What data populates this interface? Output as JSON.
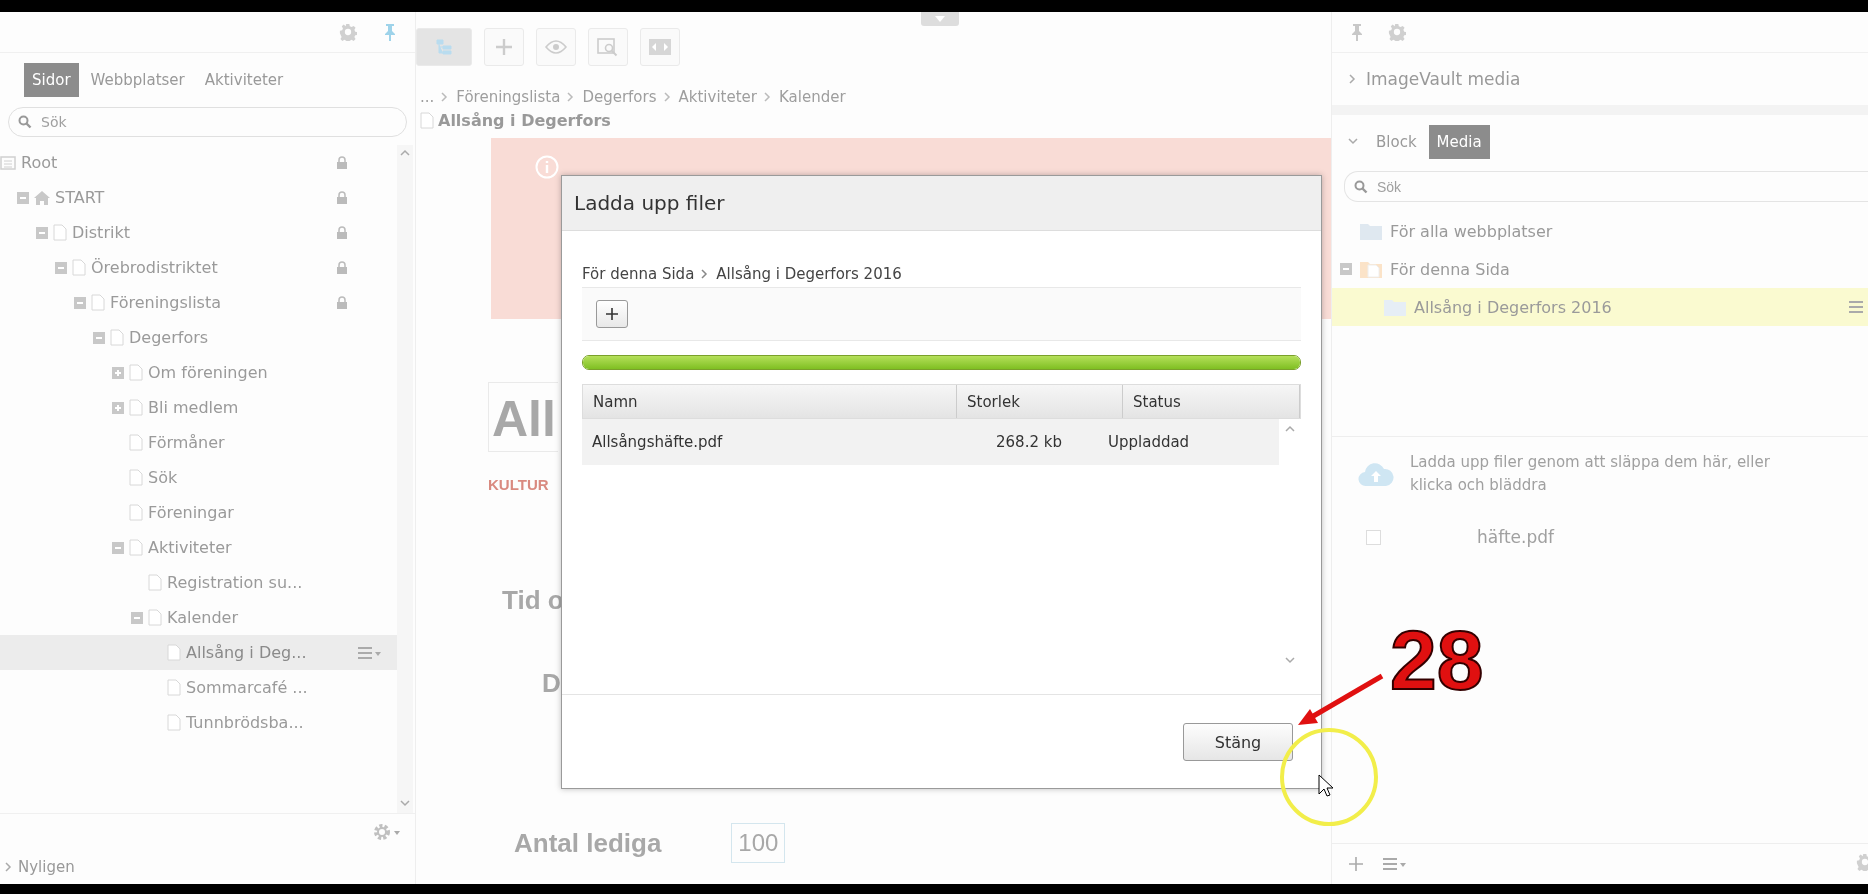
{
  "left_panel": {
    "tabs": [
      {
        "label": "Sidor",
        "selected": true
      },
      {
        "label": "Webbplatser",
        "selected": false
      },
      {
        "label": "Aktiviteter",
        "selected": false
      }
    ],
    "search": {
      "placeholder": "Sök"
    },
    "tree": [
      {
        "label": "Root",
        "kind": "root",
        "locked": true,
        "selected": false,
        "children": [
          {
            "label": "START",
            "kind": "home",
            "locked": true,
            "selected": false,
            "expanded": true,
            "children": [
              {
                "label": "Distrikt",
                "kind": "page",
                "locked": true,
                "selected": false,
                "expanded": true,
                "children": [
                  {
                    "label": "Örebrodistriktet",
                    "kind": "page",
                    "locked": true,
                    "selected": false,
                    "expanded": true,
                    "children": [
                      {
                        "label": "Föreningslista",
                        "kind": "page",
                        "locked": true,
                        "selected": false,
                        "expanded": true,
                        "children": [
                          {
                            "label": "Degerfors",
                            "kind": "page",
                            "locked": false,
                            "selected": false,
                            "expanded": true,
                            "children": [
                              {
                                "label": "Om föreningen",
                                "kind": "page",
                                "locked": false,
                                "selected": false,
                                "expanded": false
                              },
                              {
                                "label": "Bli medlem",
                                "kind": "page",
                                "locked": false,
                                "selected": false,
                                "expanded": false
                              },
                              {
                                "label": "Förmåner",
                                "kind": "page",
                                "locked": false,
                                "selected": false
                              },
                              {
                                "label": "Sök",
                                "kind": "page",
                                "locked": false,
                                "selected": false
                              },
                              {
                                "label": "Föreningar",
                                "kind": "page",
                                "locked": false,
                                "selected": false
                              },
                              {
                                "label": "Aktiviteter",
                                "kind": "page",
                                "locked": false,
                                "selected": false,
                                "expanded": true,
                                "children": [
                                  {
                                    "label": "Registration su...",
                                    "kind": "page",
                                    "locked": false,
                                    "selected": false
                                  },
                                  {
                                    "label": "Kalender",
                                    "kind": "page",
                                    "locked": false,
                                    "selected": false,
                                    "expanded": true,
                                    "children": [
                                      {
                                        "label": "Allsång i Deg...",
                                        "kind": "page",
                                        "locked": false,
                                        "selected": true
                                      },
                                      {
                                        "label": "Sommarcafé ...",
                                        "kind": "page",
                                        "locked": false,
                                        "selected": false
                                      },
                                      {
                                        "label": "Tunnbrödsba...",
                                        "kind": "page",
                                        "locked": false,
                                        "selected": false
                                      }
                                    ]
                                  }
                                ]
                              }
                            ]
                          }
                        ]
                      }
                    ]
                  }
                ]
              }
            ]
          }
        ]
      }
    ],
    "footer": {
      "label": "Nyligen"
    }
  },
  "editor": {
    "toolbar": [
      {
        "kind": "tree",
        "selected": true
      },
      {
        "kind": "add",
        "selected": false
      },
      {
        "kind": "view",
        "selected": false
      },
      {
        "kind": "preview",
        "selected": false
      },
      {
        "kind": "compare",
        "selected": false
      }
    ],
    "breadcrumb": [
      "...",
      "Föreningslista",
      "Degerfors",
      "Aktiviteter",
      "Kalender"
    ],
    "page_title": "Allsång i Degerfors",
    "heading": "All",
    "category": "KULTUR",
    "label_1": "Tid o",
    "label_2": "D",
    "label_3": "Antal lediga",
    "value_3": "100"
  },
  "dialog": {
    "title": "Ladda upp filer",
    "path": [
      "För denna Sida",
      "Allsång i Degerfors 2016"
    ],
    "progress": {
      "level": 1
    },
    "columns": [
      "Namn",
      "Storlek",
      "Status"
    ],
    "rows": [
      [
        "Allsångshäfte.pdf",
        "268.2 kb",
        "Uppladdad"
      ]
    ],
    "button": "Stäng"
  },
  "right_panel": {
    "header": "ImageVault media",
    "tabs": [
      {
        "label": "Block",
        "selected": false
      },
      {
        "label": "Media",
        "selected": true
      }
    ],
    "search": {
      "placeholder": "Sök"
    },
    "tree": [
      {
        "label": "För alla webbplatser",
        "kind": "shared",
        "selected": false
      },
      {
        "label": "För denna Sida",
        "kind": "page",
        "selected": false,
        "expanded": true,
        "children": [
          {
            "label": "Allsång i Degerfors 2016",
            "kind": "folder",
            "selected": true
          }
        ]
      }
    ],
    "upload_hint": "Ladda upp filer genom att släppa dem här, eller klicka och bläddra",
    "files": [
      {
        "name": "häfte.pdf",
        "checked": false
      }
    ]
  },
  "annotation": {
    "label": "28"
  }
}
